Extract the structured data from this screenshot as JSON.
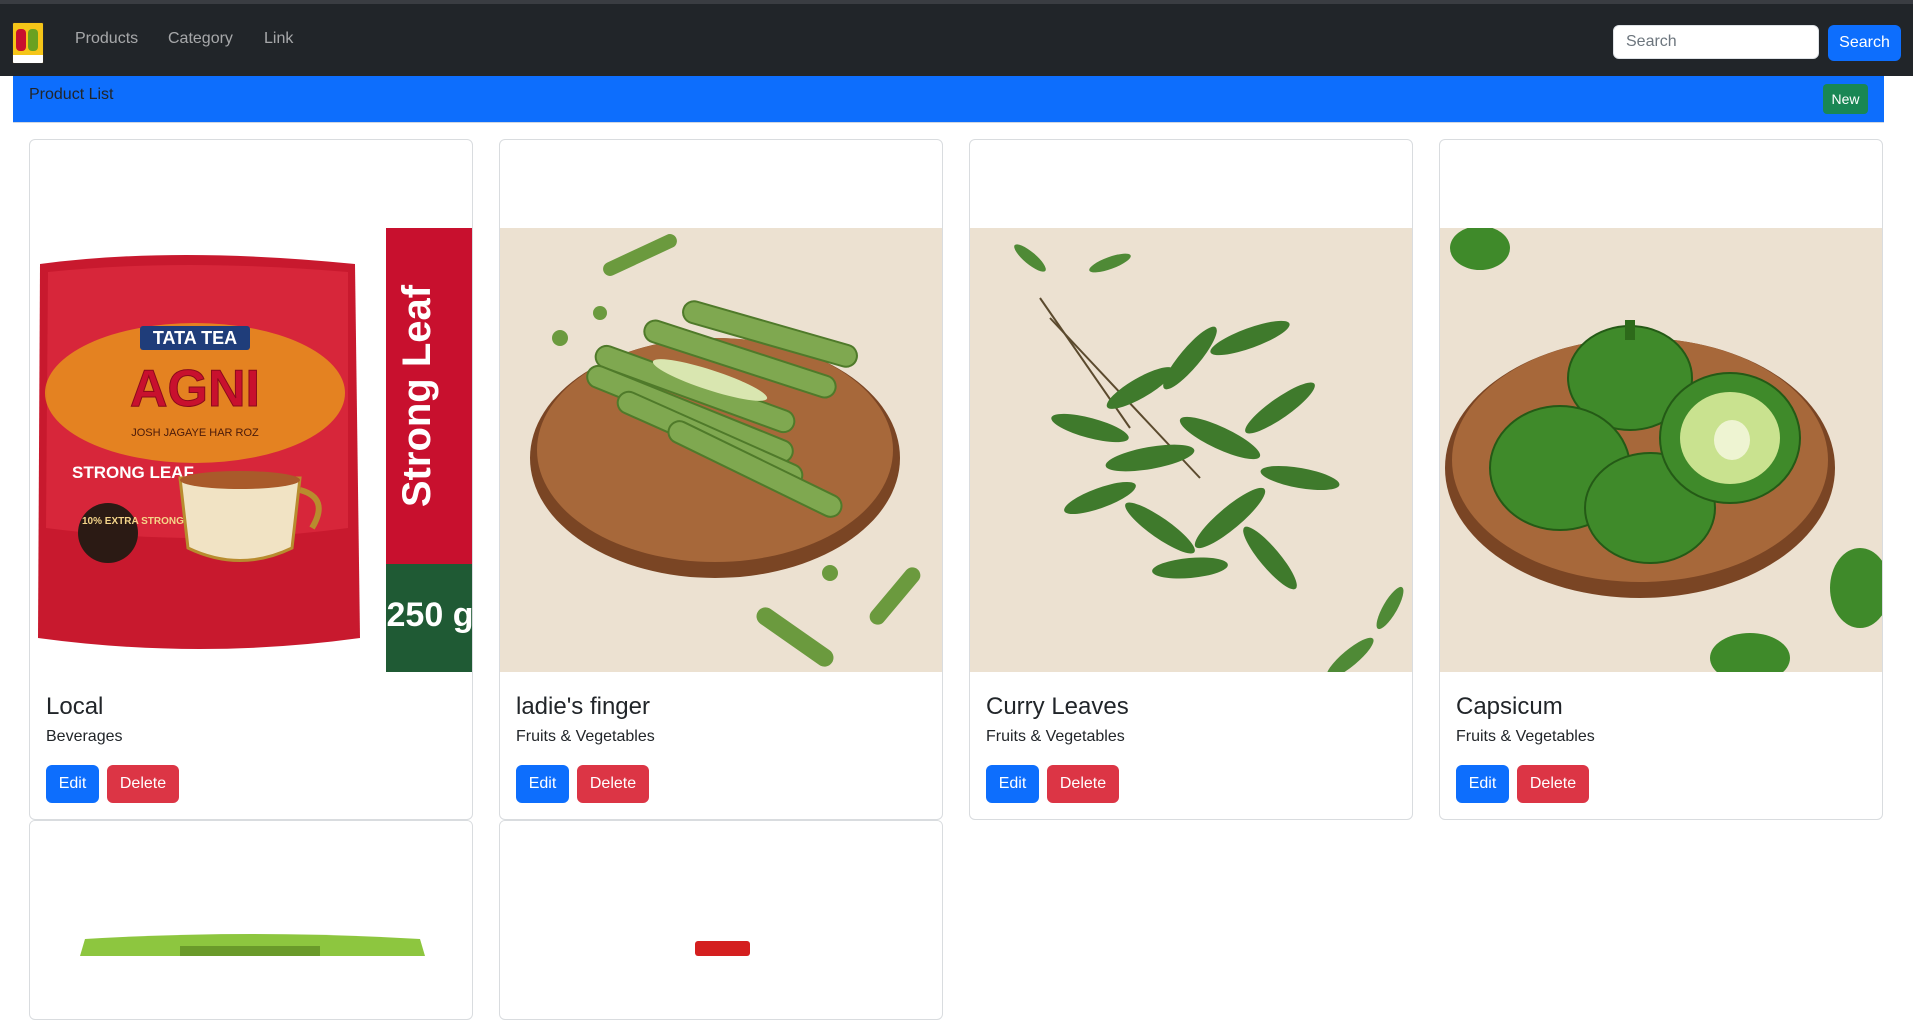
{
  "navbar": {
    "brand": "bigbasket",
    "links": [
      "Products",
      "Category",
      "Link"
    ],
    "search_placeholder": "Search",
    "search_button": "Search"
  },
  "list_header": {
    "title": "Product List",
    "new_button": "New"
  },
  "products": [
    {
      "name": "Local",
      "category": "Beverages",
      "edit": "Edit",
      "delete": "Delete",
      "package": {
        "brand": "TATA TEA",
        "product": "AGNI",
        "tagline": "JOSH JAGAYE HAR ROZ",
        "variant": "STRONG LEAF",
        "offer": "10% EXTRA STRONG LEAVES",
        "side_label": "Strong Leaf",
        "weight": "250 g"
      }
    },
    {
      "name": "ladie's finger",
      "category": "Fruits & Vegetables",
      "edit": "Edit",
      "delete": "Delete"
    },
    {
      "name": "Curry Leaves",
      "category": "Fruits & Vegetables",
      "edit": "Edit",
      "delete": "Delete"
    },
    {
      "name": "Capsicum",
      "category": "Fruits & Vegetables",
      "edit": "Edit",
      "delete": "Delete"
    }
  ],
  "colors": {
    "navbar_bg": "#212529",
    "primary": "#0d6efd",
    "success": "#198754",
    "danger": "#dc3545"
  }
}
